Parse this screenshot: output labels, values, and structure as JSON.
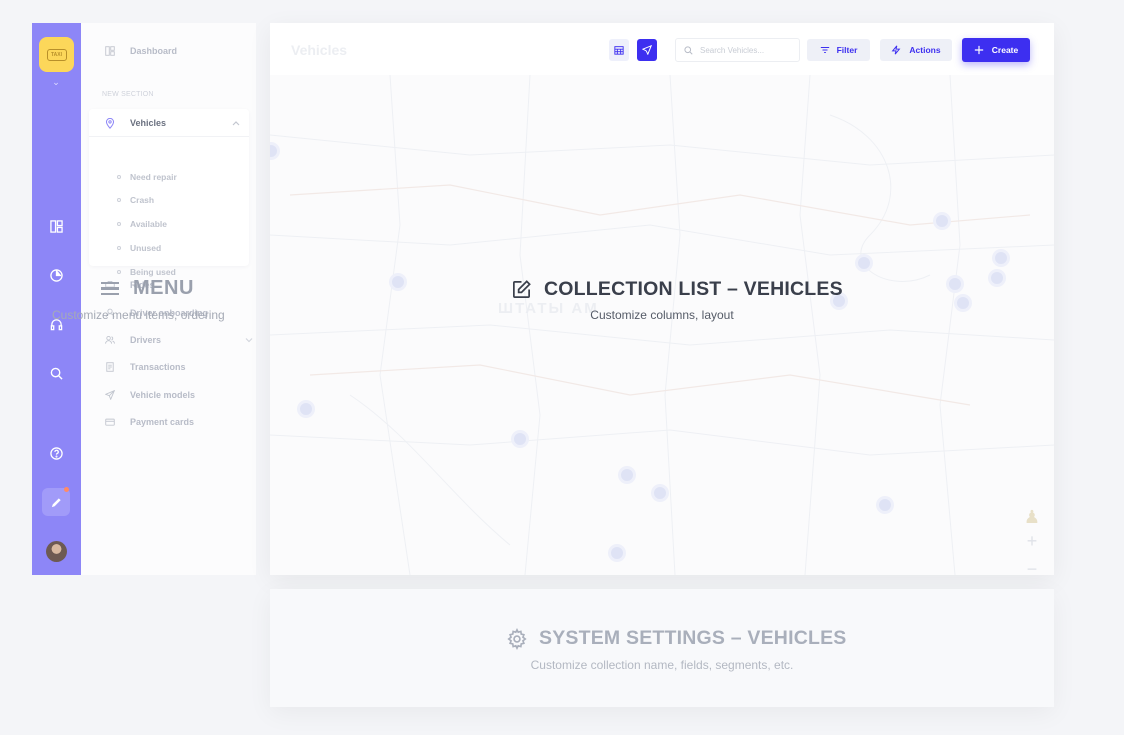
{
  "colors": {
    "accent": "#3d2ff0",
    "rail": "#8d86f7",
    "logo": "#fcd75a"
  },
  "logo": {
    "text": "TAXI"
  },
  "sidebar": {
    "dashboard": "Dashboard",
    "section_label": "NEW SECTION",
    "vehicles": "Vehicles",
    "vehicles_sub": [
      "Need repair",
      "Crash",
      "Available",
      "Unused",
      "Being used"
    ],
    "rides": "Rides",
    "driver_onboarding": "Driver onboarding",
    "drivers": "Drivers",
    "transactions": "Transactions",
    "vehicle_models": "Vehicle models",
    "payment_cards": "Payment cards"
  },
  "menu_overlay": {
    "title": "MENU",
    "subtitle": "Customize menu items, ordering"
  },
  "main": {
    "page_title": "Vehicles",
    "search_placeholder": "Search Vehicles...",
    "filter_label": "Filter",
    "actions_label": "Actions",
    "create_label": "Create",
    "overlay_title": "COLLECTION LIST – VEHICLES",
    "overlay_subtitle": "Customize columns, layout",
    "map_label": "ШТАТЫ АМ"
  },
  "settings_panel": {
    "title": "SYSTEM SETTINGS – VEHICLES",
    "subtitle": "Customize collection name, fields, segments, etc."
  },
  "icons": [
    "car-icon",
    "chevron-down-icon",
    "dashboard-icon",
    "globe-icon",
    "headset-icon",
    "search-icon",
    "help-icon",
    "pencil-icon",
    "pin-icon",
    "send-icon",
    "calendar-icon",
    "filter-icon",
    "bolt-icon",
    "plus-icon",
    "edit-icon",
    "gear-icon",
    "menu-icon"
  ]
}
